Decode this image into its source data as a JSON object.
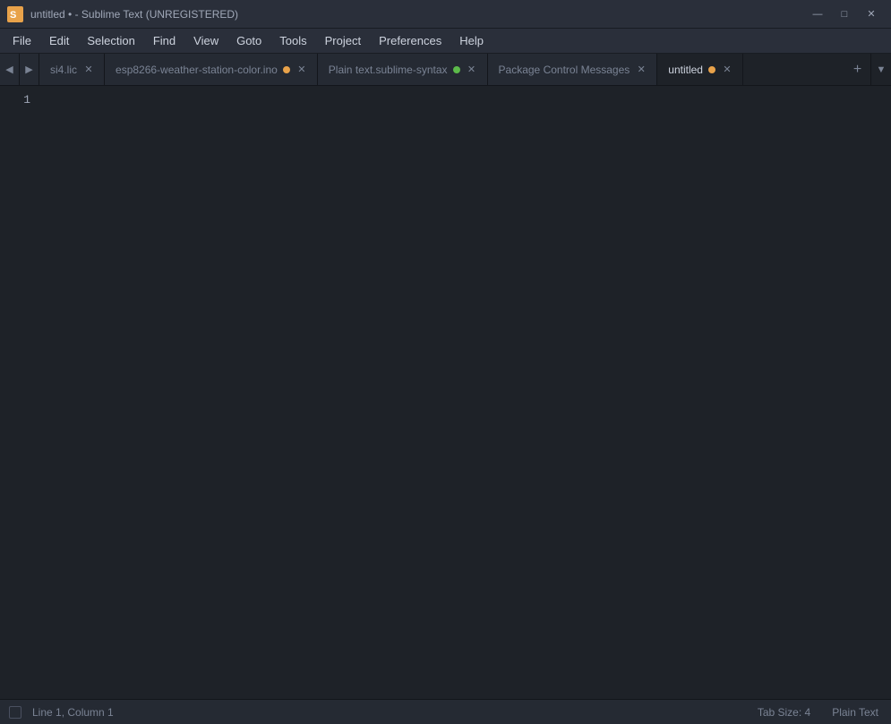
{
  "titlebar": {
    "title": "untitled • - Sublime Text (UNREGISTERED)"
  },
  "menubar": {
    "items": [
      "File",
      "Edit",
      "Selection",
      "Find",
      "View",
      "Goto",
      "Tools",
      "Project",
      "Preferences",
      "Help"
    ]
  },
  "tabs": [
    {
      "id": "tab-prev",
      "type": "nav",
      "label": "◀"
    },
    {
      "id": "tab-next",
      "type": "nav",
      "label": "▶"
    },
    {
      "id": "si4",
      "label": "si4.lic",
      "closeable": true,
      "dot": false,
      "active": false
    },
    {
      "id": "esp",
      "label": "esp8266-weather-station-color.ino",
      "closeable": true,
      "dot": "unsaved",
      "active": false
    },
    {
      "id": "plaintext-syntax",
      "label": "Plain text.sublime-syntax",
      "closeable": true,
      "dot": "green",
      "active": false
    },
    {
      "id": "package-control",
      "label": "Package Control Messages",
      "closeable": true,
      "dot": false,
      "active": false
    },
    {
      "id": "untitled",
      "label": "untitled",
      "closeable": true,
      "dot": "unsaved",
      "active": true
    }
  ],
  "editor": {
    "line_numbers": [
      "1"
    ],
    "active_line": 1
  },
  "statusbar": {
    "position": "Line 1, Column 1",
    "tab_size": "Tab Size: 4",
    "syntax": "Plain Text"
  },
  "window_controls": {
    "minimize": "—",
    "maximize": "□",
    "close": "✕"
  }
}
